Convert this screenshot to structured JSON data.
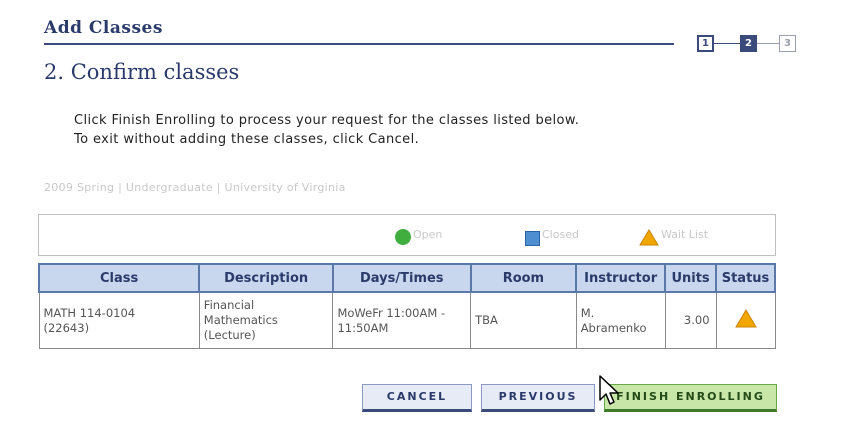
{
  "header": {
    "title": "Add Classes"
  },
  "steps": [
    "1",
    "2",
    "3"
  ],
  "page_title": "2. Confirm classes",
  "instructions": [
    "Click Finish Enrolling to process your request for the classes listed below.",
    "To exit without adding these classes, click Cancel."
  ],
  "term_line": "2009 Spring | Undergraduate | University of Virginia",
  "legend": {
    "open": "Open",
    "closed": "Closed",
    "wait_list": "Wait List",
    "colors": {
      "open": "#3fae3f",
      "closed": "#4f8fd1",
      "wait_list": "#f2a600"
    }
  },
  "table": {
    "headers": [
      "Class",
      "Description",
      "Days/Times",
      "Room",
      "Instructor",
      "Units",
      "Status"
    ],
    "rows": [
      {
        "class_code": "MATH 114-0104",
        "class_number": "(22643)",
        "description": [
          "Financial",
          "Mathematics",
          "(Lecture)"
        ],
        "days_times": [
          "MoWeFr 11:00AM -",
          "11:50AM"
        ],
        "room": "TBA",
        "instructor": [
          "M.",
          "Abramenko"
        ],
        "units": "3.00",
        "status_icon": "warning-triangle-icon"
      }
    ]
  },
  "buttons": {
    "cancel": "Cancel",
    "previous": "Previous",
    "finish": "Finish Enrolling"
  }
}
